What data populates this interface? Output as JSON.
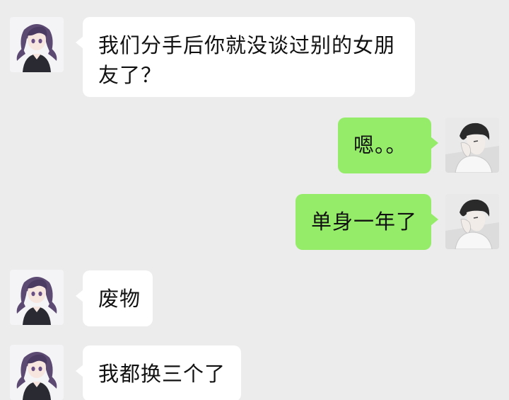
{
  "messages": [
    {
      "side": "left",
      "avatar_icon": "girl-avatar-icon",
      "text": "我们分手后你就没谈过别的女朋友了？"
    },
    {
      "side": "right",
      "avatar_icon": "boy-avatar-icon",
      "text": "嗯。。"
    },
    {
      "side": "right",
      "avatar_icon": "boy-avatar-icon",
      "text": "单身一年了"
    },
    {
      "side": "left",
      "avatar_icon": "girl-avatar-icon",
      "text": "废物"
    },
    {
      "side": "left",
      "avatar_icon": "girl-avatar-icon",
      "text": "我都换三个了"
    }
  ],
  "colors": {
    "background": "#ececec",
    "received_bubble": "#ffffff",
    "sent_bubble": "#95ec69",
    "text": "#111111"
  }
}
